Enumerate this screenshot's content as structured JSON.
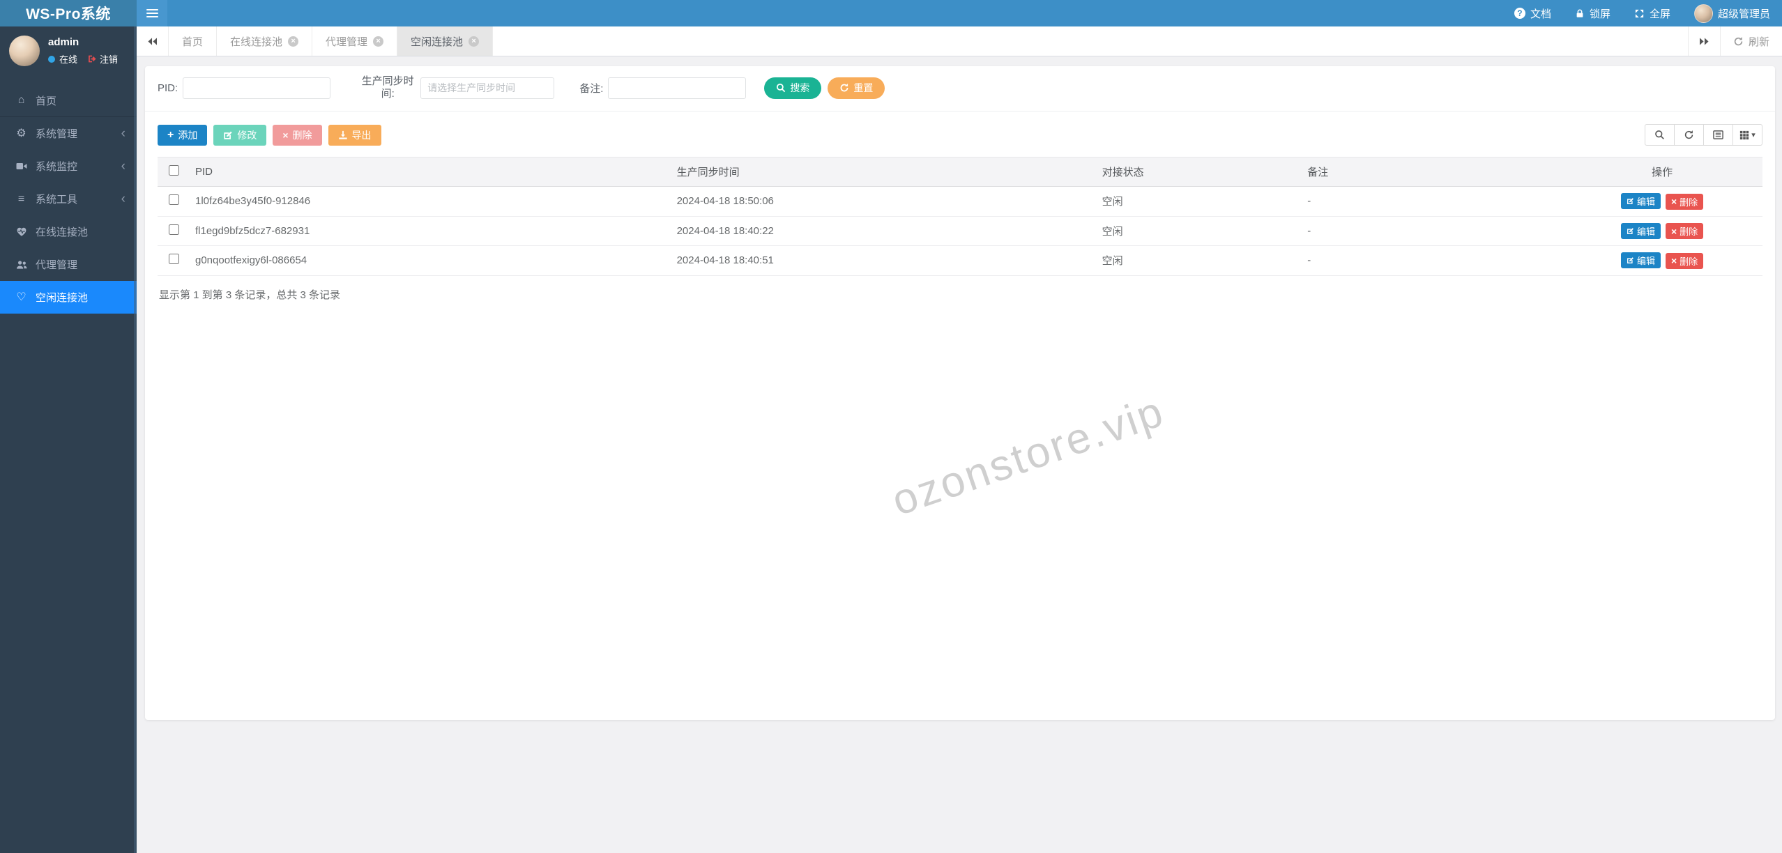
{
  "navbar": {
    "brand": "WS-Pro系统",
    "docs": "文档",
    "lock_screen": "锁屏",
    "fullscreen": "全屏",
    "role": "超级管理员"
  },
  "sidebar": {
    "username": "admin",
    "status_online": "在线",
    "logout": "注销",
    "items": [
      {
        "label": "首页"
      },
      {
        "label": "系统管理"
      },
      {
        "label": "系统监控"
      },
      {
        "label": "系统工具"
      },
      {
        "label": "在线连接池"
      },
      {
        "label": "代理管理"
      },
      {
        "label": "空闲连接池"
      }
    ]
  },
  "tabs": {
    "items": [
      {
        "label": "首页"
      },
      {
        "label": "在线连接池"
      },
      {
        "label": "代理管理"
      },
      {
        "label": "空闲连接池"
      }
    ],
    "refresh_label": "刷新"
  },
  "search": {
    "pid_label": "PID:",
    "time_label": "生产同步时间:",
    "time_placeholder": "请选择生产同步时间",
    "note_label": "备注:",
    "search_button": "搜索",
    "reset_button": "重置"
  },
  "toolbar": {
    "add": "添加",
    "modify": "修改",
    "delete": "删除",
    "export": "导出"
  },
  "table": {
    "headers": {
      "pid": "PID",
      "sync_time": "生产同步时间",
      "status": "对接状态",
      "note": "备注",
      "actions": "操作"
    },
    "rows": [
      {
        "pid": "1l0fz64be3y45f0-912846",
        "sync_time": "2024-04-18 18:50:06",
        "status": "空闲",
        "note": "-"
      },
      {
        "pid": "fl1egd9bfz5dcz7-682931",
        "sync_time": "2024-04-18 18:40:22",
        "status": "空闲",
        "note": "-"
      },
      {
        "pid": "g0nqootfexigy6l-086654",
        "sync_time": "2024-04-18 18:40:51",
        "status": "空闲",
        "note": "-"
      }
    ],
    "edit_button": "编辑",
    "delete_button": "删除",
    "summary": "显示第 1 到第 3 条记录，总共 3 条记录"
  },
  "watermark": "ozonstore.vip",
  "colors": {
    "navbar": "#3d8fc7",
    "navbar_brand": "#3a80aa",
    "sidebar": "#2f4050",
    "sidebar_active": "#1a89fc",
    "primary": "#1c84c6",
    "success": "#1ab394",
    "warning": "#f8ac59",
    "danger": "#e9544f",
    "modify_muted": "#6bd4bb",
    "delete_muted": "#f19b9b"
  }
}
